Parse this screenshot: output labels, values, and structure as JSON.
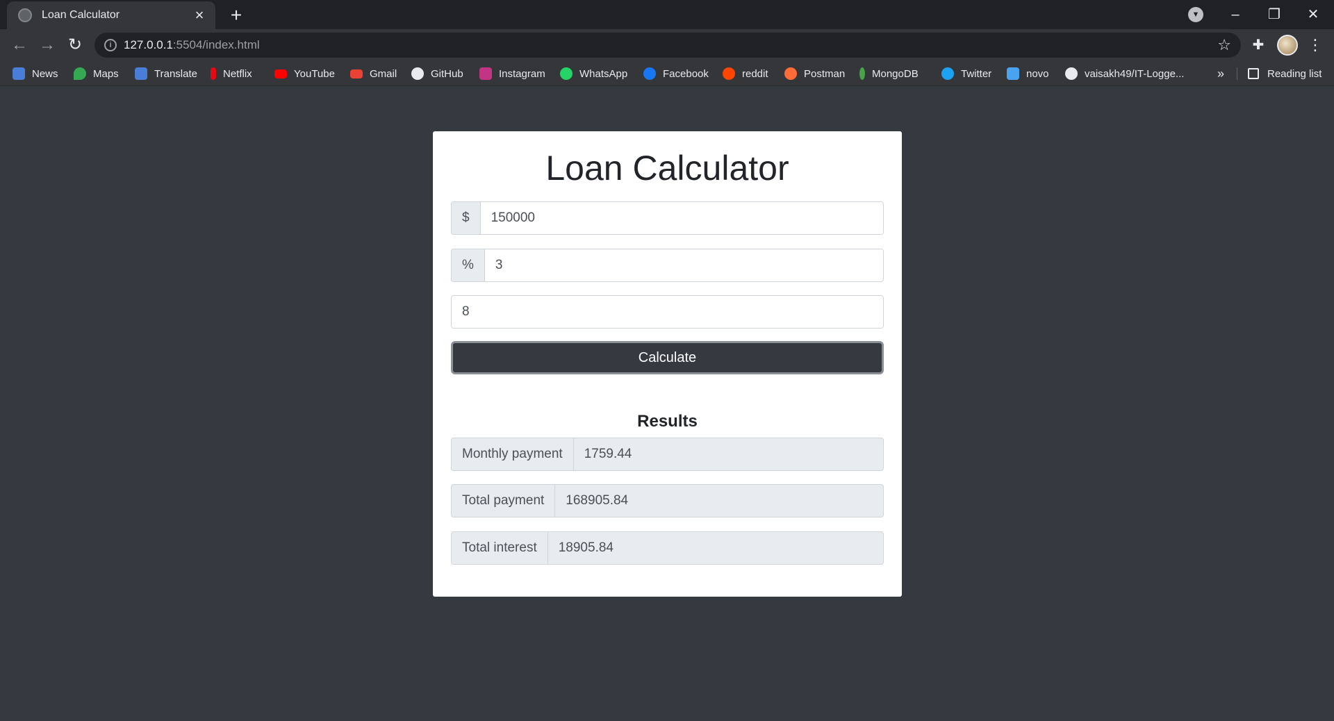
{
  "browser": {
    "tab_title": "Loan Calculator",
    "url_host": "127.0.0.1",
    "url_path": ":5504/index.html",
    "bookmarks": [
      {
        "label": "News",
        "color": "#4a7dd8"
      },
      {
        "label": "Maps",
        "color": "#34a853"
      },
      {
        "label": "Translate",
        "color": "#4a7dd8"
      },
      {
        "label": "Netflix",
        "color": "#e50914"
      },
      {
        "label": "YouTube",
        "color": "#ff0000"
      },
      {
        "label": "Gmail",
        "color": "#ea4335"
      },
      {
        "label": "GitHub",
        "color": "#e8eaed"
      },
      {
        "label": "Instagram",
        "color": "#c13584"
      },
      {
        "label": "WhatsApp",
        "color": "#25d366"
      },
      {
        "label": "Facebook",
        "color": "#1877f2"
      },
      {
        "label": "reddit",
        "color": "#ff4500"
      },
      {
        "label": "Postman",
        "color": "#ff6c37"
      },
      {
        "label": "MongoDB",
        "color": "#47a248"
      },
      {
        "label": "Twitter",
        "color": "#1da1f2"
      },
      {
        "label": "novo",
        "color": "#4aa3f0"
      },
      {
        "label": "vaisakh49/IT-Logge...",
        "color": "#e8eaed"
      }
    ],
    "more_label": "»",
    "reading_list": "Reading list"
  },
  "calculator": {
    "title": "Loan Calculator",
    "amount_addon": "$",
    "amount_value": "150000",
    "interest_addon": "%",
    "interest_value": "3",
    "years_value": "8",
    "calculate_label": "Calculate"
  },
  "results": {
    "title": "Results",
    "monthly_label": "Monthly payment",
    "monthly_value": "1759.44",
    "total_label": "Total payment",
    "total_value": "168905.84",
    "interest_label": "Total interest",
    "interest_value": "18905.84"
  }
}
